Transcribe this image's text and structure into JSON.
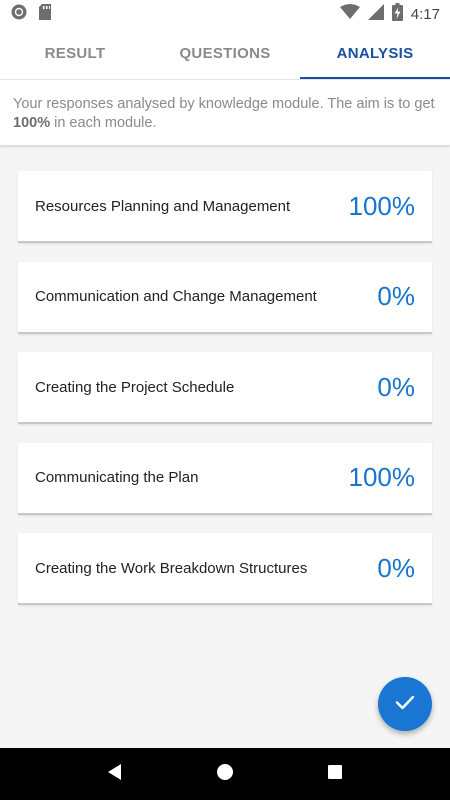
{
  "status_bar": {
    "time": "4:17",
    "icons": [
      "circle-notification-icon",
      "sd-card-icon",
      "wifi-icon",
      "signal-icon",
      "battery-charging-icon"
    ]
  },
  "tabs": [
    {
      "label": "RESULT",
      "active": false
    },
    {
      "label": "QUESTIONS",
      "active": false
    },
    {
      "label": "ANALYSIS",
      "active": true
    }
  ],
  "info": {
    "text_before": "Your responses analysed by knowledge module. The aim is to get ",
    "highlight": "100%",
    "text_after": " in each module."
  },
  "modules": [
    {
      "name": "Resources Planning and Management",
      "score": "100%"
    },
    {
      "name": "Communication and Change Management",
      "score": "0%"
    },
    {
      "name": "Creating the Project Schedule",
      "score": "0%"
    },
    {
      "name": "Communicating the Plan",
      "score": "100%"
    },
    {
      "name": "Creating the Work Breakdown Structures",
      "score": "0%"
    }
  ],
  "fab": {
    "icon": "check-icon"
  },
  "nav": {
    "icons": [
      "back-icon",
      "home-icon",
      "recents-icon"
    ]
  },
  "colors": {
    "accent": "#1b4fa0",
    "score": "#1874cd",
    "fab": "#1976d2"
  }
}
